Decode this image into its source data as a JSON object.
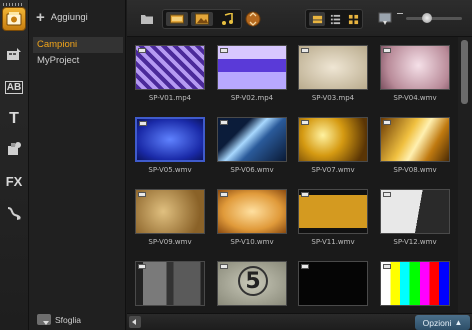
{
  "toolstrip": {
    "tools": [
      {
        "name": "media-icon",
        "label": ""
      },
      {
        "name": "instant-project-icon",
        "label": ""
      },
      {
        "name": "transition-icon",
        "label": "AB"
      },
      {
        "name": "title-icon",
        "label": "T"
      },
      {
        "name": "graphics-icon",
        "label": ""
      },
      {
        "name": "filter-icon",
        "label": "FX"
      },
      {
        "name": "path-icon",
        "label": ""
      }
    ]
  },
  "library": {
    "add_label": "Aggiungi",
    "items": [
      {
        "label": "Campioni",
        "selected": true
      },
      {
        "label": "MyProject",
        "selected": false
      }
    ],
    "browse_label": "Sfoglia"
  },
  "toolbar": {
    "folder_icon": "folder-icon",
    "filters": [
      "video-filter-icon",
      "photo-filter-icon",
      "audio-filter-icon"
    ],
    "sort_icon": "sort-icon",
    "views": [
      "thumbnail-view-icon",
      "list-view-icon",
      "grid-view-icon"
    ],
    "import_icon": "import-icon",
    "zoom_level": 0.35
  },
  "media": {
    "items": [
      {
        "label": "SP-V01.mp4",
        "style": "purple-tiles"
      },
      {
        "label": "SP-V02.mp4",
        "style": "purple-stripe"
      },
      {
        "label": "SP-V03.mp4",
        "style": "beige-frame"
      },
      {
        "label": "SP-V04.wmv",
        "style": "pink-swirl"
      },
      {
        "label": "SP-V05.wmv",
        "style": "blue-frame"
      },
      {
        "label": "SP-V06.wmv",
        "style": "blue-light"
      },
      {
        "label": "SP-V07.wmv",
        "style": "gold-bokeh"
      },
      {
        "label": "SP-V08.wmv",
        "style": "gold-rays"
      },
      {
        "label": "SP-V09.wmv",
        "style": "vintage-map"
      },
      {
        "label": "SP-V10.wmv",
        "style": "orange-glow"
      },
      {
        "label": "SP-V11.wmv",
        "style": "film-strip"
      },
      {
        "label": "SP-V12.wmv",
        "style": "white-frames"
      },
      {
        "label": "",
        "style": "gray-panels"
      },
      {
        "label": "",
        "style": "countdown"
      },
      {
        "label": "",
        "style": "black"
      },
      {
        "label": "",
        "style": "test-pattern"
      }
    ],
    "countdown_number": "5"
  },
  "bottombar": {
    "options_label": "Opzioni"
  }
}
